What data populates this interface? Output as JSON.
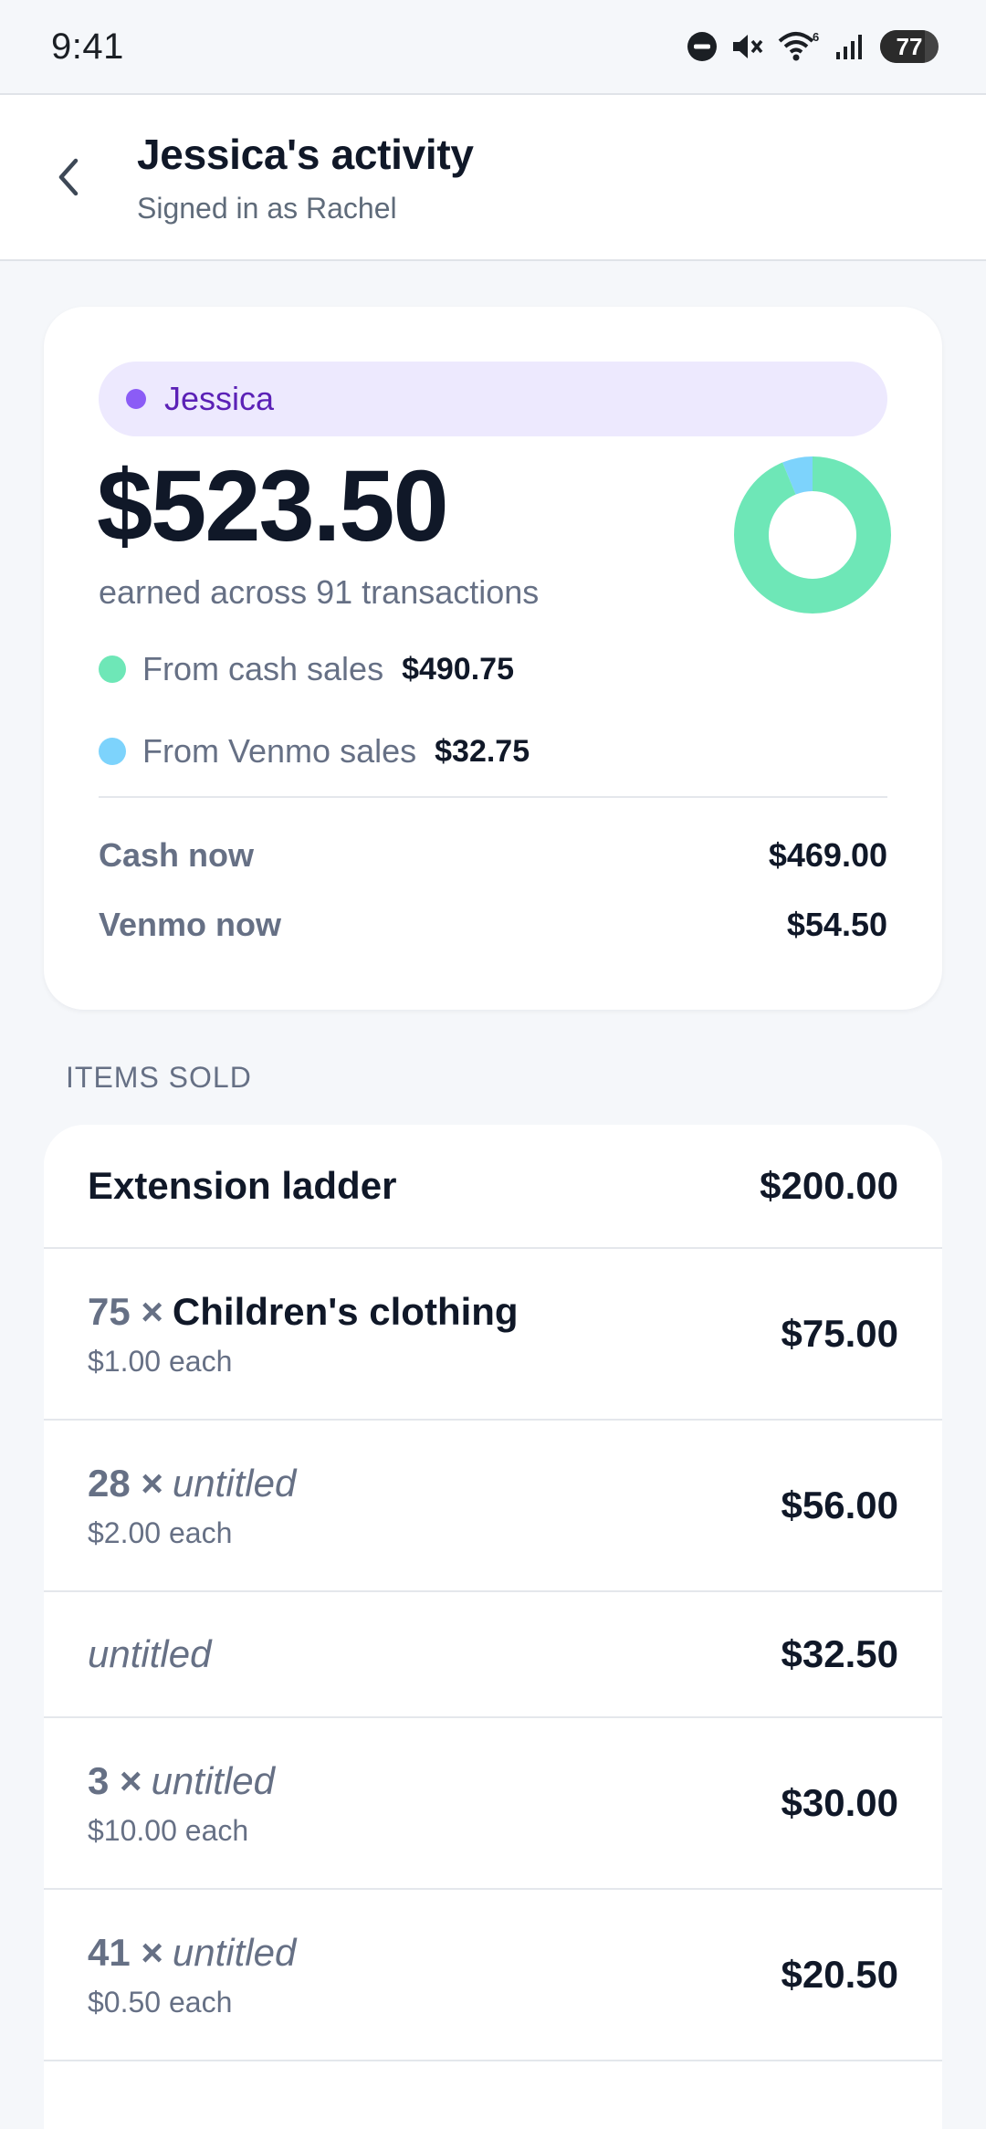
{
  "status_bar": {
    "time": "9:41",
    "icons": [
      "do-not-disturb-icon",
      "mute-icon",
      "wifi-icon",
      "signal-icon"
    ],
    "wifi_badge": "6",
    "battery": "77",
    "battery_level": 0.77
  },
  "header": {
    "back_icon": "chevron-left-icon",
    "title": "Jessica's activity",
    "subtitle": "Signed in as Rachel"
  },
  "summary": {
    "person": "Jessica",
    "person_color": "#8b5cf6",
    "total": "$523.50",
    "caption": "earned across 91 transactions",
    "breakdown": [
      {
        "label": "From cash sales",
        "value": "$490.75",
        "amount": 490.75,
        "color": "#6ee7b7"
      },
      {
        "label": "From Venmo sales",
        "value": "$32.75",
        "amount": 32.75,
        "color": "#7dd3fc"
      }
    ],
    "balances": [
      {
        "label": "Cash now",
        "value": "$469.00"
      },
      {
        "label": "Venmo now",
        "value": "$54.50"
      }
    ]
  },
  "items_section": {
    "label": "ITEMS SOLD",
    "items": [
      {
        "qty": "",
        "name": "Extension ladder",
        "untitled": false,
        "each": "",
        "price": "$200.00"
      },
      {
        "qty": "75 ×",
        "name": "Children's clothing",
        "untitled": false,
        "each": "$1.00 each",
        "price": "$75.00"
      },
      {
        "qty": "28 ×",
        "name": "untitled",
        "untitled": true,
        "each": "$2.00 each",
        "price": "$56.00"
      },
      {
        "qty": "",
        "name": "untitled",
        "untitled": true,
        "each": "",
        "price": "$32.50"
      },
      {
        "qty": "3 ×",
        "name": "untitled",
        "untitled": true,
        "each": "$10.00 each",
        "price": "$30.00"
      },
      {
        "qty": "41 ×",
        "name": "untitled",
        "untitled": true,
        "each": "$0.50 each",
        "price": "$20.50"
      }
    ]
  }
}
